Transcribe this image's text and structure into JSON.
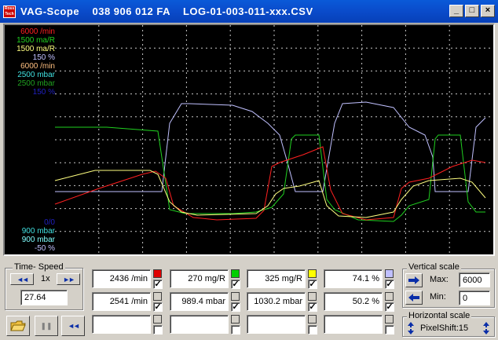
{
  "window": {
    "icon_text": "Ross Tech",
    "title": "VAG-Scope    038 906 012 FA    LOG-01-003-011-xxx.CSV",
    "minimize": "_",
    "maximize": "□",
    "close": "×"
  },
  "legend_top": [
    {
      "text": "6000 /min",
      "color": "#ff2020"
    },
    {
      "text": "1500 ma/R",
      "color": "#20d020"
    },
    {
      "text": "1500 ma/R",
      "color": "#ffff80"
    },
    {
      "text": "150 %",
      "color": "#c0c0ff"
    },
    {
      "text": "6000 /min",
      "color": "#ffc080"
    },
    {
      "text": "2500 mbar",
      "color": "#40e0e0"
    },
    {
      "text": "2500 mbar",
      "color": "#20a020"
    },
    {
      "text": "150 %",
      "color": "#2020c0"
    }
  ],
  "legend_bottom": [
    {
      "text": "0/0",
      "color": "#2020c0"
    },
    {
      "text": "900 mbar",
      "color": "#40e0e0"
    },
    {
      "text": "900 mbar",
      "color": "#80ffff"
    },
    {
      "text": "-50 %",
      "color": "#c0c0ff"
    }
  ],
  "time_speed": {
    "label": "Time- Speed",
    "rewind": "◄◄",
    "speed": "1x",
    "forward": "►►",
    "value": "27.64"
  },
  "channels": [
    {
      "value": "2436 /min",
      "color": "#e00000",
      "checked": true
    },
    {
      "value": "270 mg/R",
      "color": "#00d000",
      "checked": true
    },
    {
      "value": "325 mg/R",
      "color": "#ffff00",
      "checked": true
    },
    {
      "value": "74.1 %",
      "color": "#c0c0ff",
      "checked": true
    },
    {
      "value": "2541 /min",
      "color": "#d4d0c8",
      "checked": true
    },
    {
      "value": "989.4 mbar",
      "color": "#d4d0c8",
      "checked": true
    },
    {
      "value": "1030.2 mbar",
      "color": "#d4d0c8",
      "checked": true
    },
    {
      "value": "50.2 %",
      "color": "#d4d0c8",
      "checked": true
    },
    {
      "value": "",
      "color": "#d4d0c8",
      "checked": false
    },
    {
      "value": "",
      "color": "#d4d0c8",
      "checked": false
    },
    {
      "value": "",
      "color": "#d4d0c8",
      "checked": false
    },
    {
      "value": "",
      "color": "#d4d0c8",
      "checked": false
    }
  ],
  "checkmark": "✓",
  "vertical_scale": {
    "label": "Vertical scale",
    "max_label": "Max:",
    "max_value": "6000",
    "min_label": "Min:",
    "min_value": "0"
  },
  "horizontal_scale": {
    "label": "Horizontal scale",
    "pixelshift": "PixelShift:15"
  },
  "toolbar": {
    "pause": "❚❚",
    "rewind": "◄◄"
  }
}
